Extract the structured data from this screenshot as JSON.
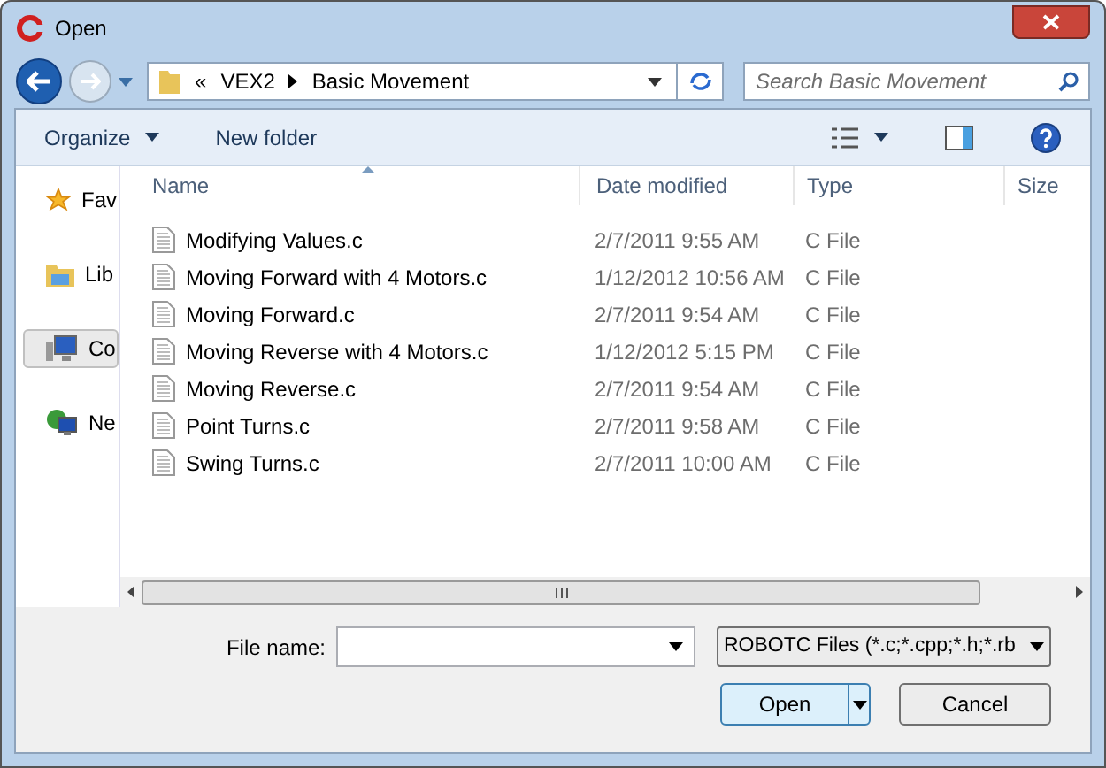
{
  "window": {
    "title": "Open"
  },
  "address": {
    "overflow": "«",
    "crumbs": [
      "VEX2",
      "Basic Movement"
    ]
  },
  "search": {
    "placeholder": "Search Basic Movement"
  },
  "toolbar": {
    "organize": "Organize",
    "new_folder": "New folder"
  },
  "sidebar": {
    "items": [
      {
        "label": "Fav",
        "kind": "star",
        "selected": false
      },
      {
        "label": "Lib",
        "kind": "library",
        "selected": false
      },
      {
        "label": "Co",
        "kind": "computer",
        "selected": true
      },
      {
        "label": "Ne",
        "kind": "network",
        "selected": false
      }
    ]
  },
  "table": {
    "columns": [
      "Name",
      "Date modified",
      "Type",
      "Size"
    ],
    "rows": [
      {
        "name": "Modifying Values.c",
        "date": "2/7/2011 9:55 AM",
        "type": "C File"
      },
      {
        "name": "Moving Forward with 4 Motors.c",
        "date": "1/12/2012 10:56 AM",
        "type": "C File"
      },
      {
        "name": "Moving Forward.c",
        "date": "2/7/2011 9:54 AM",
        "type": "C File"
      },
      {
        "name": "Moving Reverse with 4 Motors.c",
        "date": "1/12/2012 5:15 PM",
        "type": "C File"
      },
      {
        "name": "Moving Reverse.c",
        "date": "2/7/2011 9:54 AM",
        "type": "C File"
      },
      {
        "name": "Point Turns.c",
        "date": "2/7/2011 9:58 AM",
        "type": "C File"
      },
      {
        "name": "Swing Turns.c",
        "date": "2/7/2011 10:00 AM",
        "type": "C File"
      }
    ]
  },
  "file_name": {
    "label": "File name:"
  },
  "file_type": {
    "value": "ROBOTC Files (*.c;*.cpp;*.h;*.rb"
  },
  "buttons": {
    "open": "Open",
    "cancel": "Cancel"
  }
}
